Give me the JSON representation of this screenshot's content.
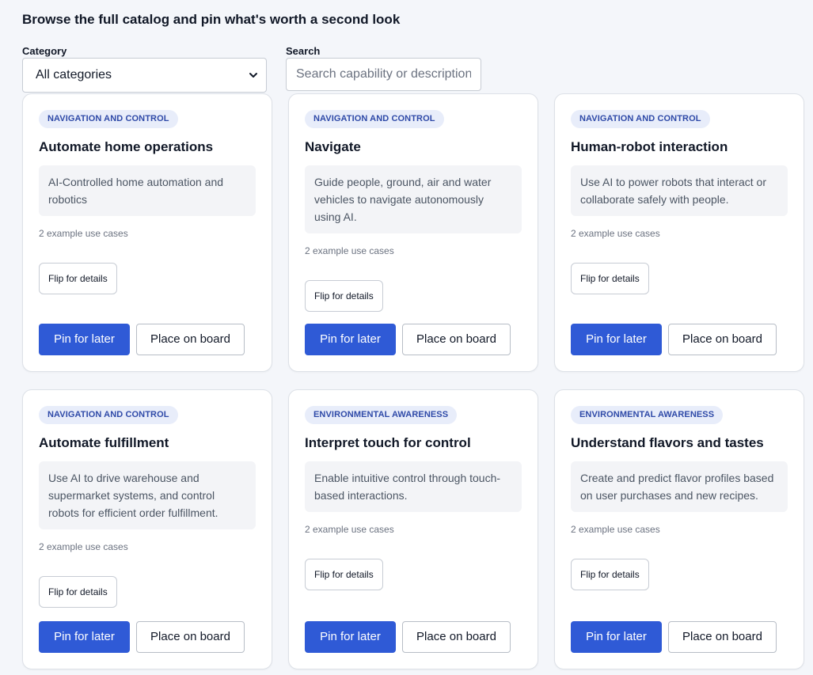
{
  "header": {
    "title": "Browse the full catalog and pin what's worth a second look"
  },
  "filters": {
    "category_label": "Category",
    "category_value": "All categories",
    "search_label": "Search",
    "search_placeholder": "Search capability or description"
  },
  "cards": [
    {
      "category": "NAVIGATION AND CONTROL",
      "title": "Automate home operations",
      "description": "AI-Controlled home automation and robotics",
      "examples": "2 example use cases",
      "flip_label": "Flip for details",
      "pin_label": "Pin for later",
      "place_label": "Place on board"
    },
    {
      "category": "NAVIGATION AND CONTROL",
      "title": "Navigate",
      "description": "Guide people, ground, air and water vehicles to navigate autonomously using AI.",
      "examples": "2 example use cases",
      "flip_label": "Flip for details",
      "pin_label": "Pin for later",
      "place_label": "Place on board"
    },
    {
      "category": "NAVIGATION AND CONTROL",
      "title": "Human-robot interaction",
      "description": "Use AI to power robots that interact or collaborate safely with people.",
      "examples": "2 example use cases",
      "flip_label": "Flip for details",
      "pin_label": "Pin for later",
      "place_label": "Place on board"
    },
    {
      "category": "NAVIGATION AND CONTROL",
      "title": "Automate fulfillment",
      "description": "Use AI to drive warehouse and supermarket systems, and control robots for efficient order fulfillment.",
      "examples": "2 example use cases",
      "flip_label": "Flip for details",
      "pin_label": "Pin for later",
      "place_label": "Place on board"
    },
    {
      "category": "ENVIRONMENTAL AWARENESS",
      "title": "Interpret touch for control",
      "description": "Enable intuitive control through touch-based interactions.",
      "examples": "2 example use cases",
      "flip_label": "Flip for details",
      "pin_label": "Pin for later",
      "place_label": "Place on board"
    },
    {
      "category": "ENVIRONMENTAL AWARENESS",
      "title": "Understand flavors and tastes",
      "description": "Create and predict flavor profiles based on user purchases and new recipes.",
      "examples": "2 example use cases",
      "flip_label": "Flip for details",
      "pin_label": "Pin for later",
      "place_label": "Place on board"
    }
  ],
  "icons": {
    "select_chevron": "chevron-down-icon"
  },
  "colors": {
    "accent": "#2f5ad6",
    "badge_bg": "#e8edfa",
    "badge_text": "#2f4aa8",
    "background": "#f4f6fa"
  }
}
